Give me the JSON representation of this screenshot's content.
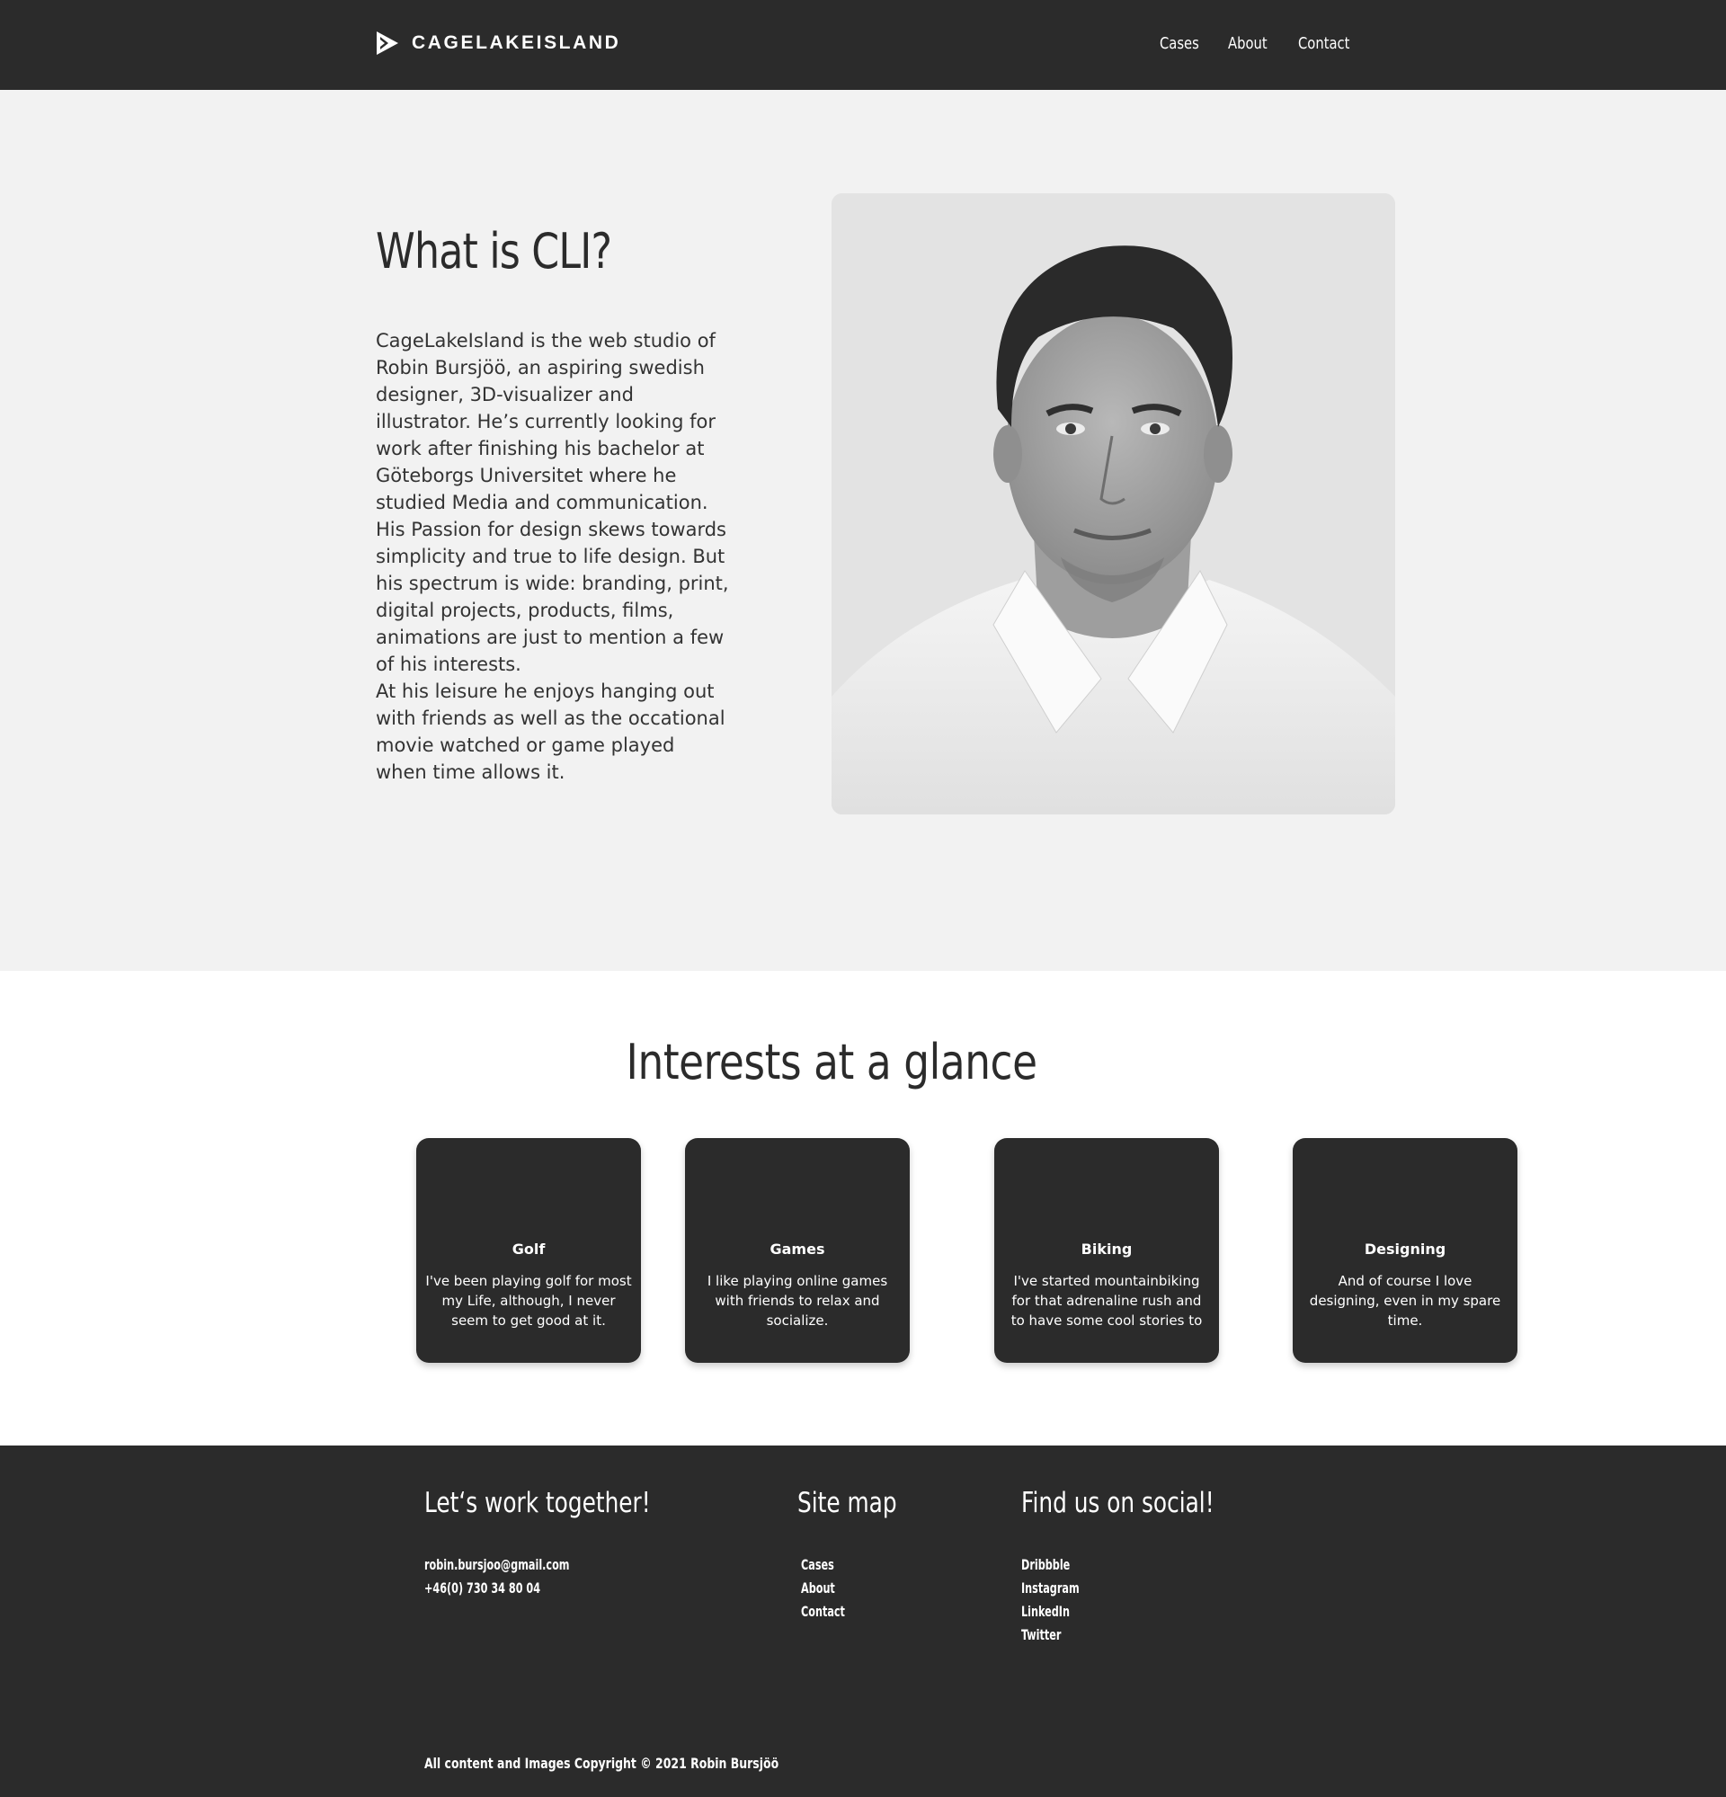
{
  "header": {
    "brand": "CAGELAKEISLAND",
    "nav": [
      "Cases",
      "About",
      "Contact"
    ]
  },
  "hero": {
    "title": "What is CLI?",
    "paragraph1": "CageLakeIsland is the web studio of Robin Bursjöö, an aspiring swedish designer, 3D-visualizer and illustrator. He’s currently looking for work after finishing his bachelor at Göteborgs Universitet where he studied Media and communication. His Passion for design skews towards simplicity and true to life design. But his spectrum is wide: branding, print, digital projects, products, films, animations are just to mention a few of his interests.",
    "paragraph2": "At his leisure he enjoys hanging out with friends as well as the occational movie watched or game played when time allows it."
  },
  "interests": {
    "title": "Interests at a glance",
    "cards": [
      {
        "title": "Golf",
        "text": "I've been playing golf for most my Life, although, I never seem to get good at it."
      },
      {
        "title": "Games",
        "text": "I like playing online games with friends to relax and socialize."
      },
      {
        "title": "Biking",
        "text": "I've started mountainbiking for that adrenaline rush and to have some cool stories to"
      },
      {
        "title": "Designing",
        "text": "And of course I love designing, even in my spare time."
      }
    ]
  },
  "footer": {
    "work_title": "Let‘s work together!",
    "email": "robin.bursjoo@gmail.com",
    "phone": "+46(0) 730 34 80 04",
    "sitemap_title": "Site map",
    "sitemap": [
      "Cases",
      "About",
      "Contact"
    ],
    "social_title": "Find us on social!",
    "social": [
      "Dribbble",
      "Instagram",
      "LinkedIn",
      "Twitter"
    ],
    "copyright": "All content and Images Copyright © 2021 Robin Bursjöö"
  },
  "colors": {
    "dark": "#2b2b2b",
    "hero_bg": "#f2f2f2",
    "text": "#333333"
  }
}
